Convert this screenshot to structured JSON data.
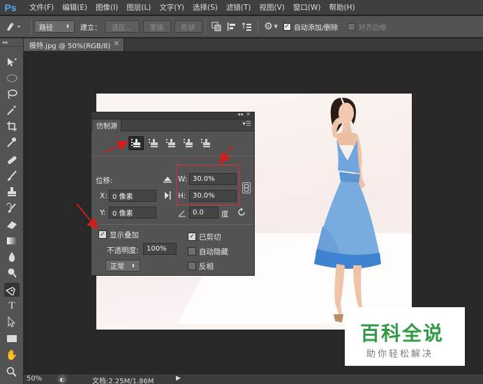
{
  "app": {
    "logo": "Ps"
  },
  "menu": [
    "文件(F)",
    "编辑(E)",
    "图像(I)",
    "图层(L)",
    "文字(Y)",
    "选择(S)",
    "滤镜(T)",
    "视图(V)",
    "窗口(W)",
    "帮助(H)"
  ],
  "options": {
    "mode_value": "路径",
    "make_label": "建立：",
    "selection_button": "选区...",
    "mask_button": "蒙版",
    "shape_button": "形状",
    "auto_add_label": "自动添加/删除",
    "auto_add_checked": true,
    "align_edges_label": "对齐边缘",
    "align_edges_checked": false
  },
  "document_tab": {
    "title": "模特.jpg @ 50%(RGB/8)",
    "close": "×"
  },
  "tools": [
    "move-tool",
    "marquee-tool",
    "lasso-tool",
    "magic-wand-tool",
    "crop-tool",
    "eyedropper-tool",
    "healing-brush-tool",
    "brush-tool",
    "clone-stamp-tool",
    "history-brush-tool",
    "eraser-tool",
    "gradient-tool",
    "blur-tool",
    "dodge-tool",
    "pen-tool",
    "type-tool",
    "path-selection-tool",
    "rectangle-tool",
    "hand-tool",
    "zoom-tool"
  ],
  "clone_source_panel": {
    "tab_label": "仿制源",
    "offset_label": "位移:",
    "x_label": "X:",
    "x_value": "0 像素",
    "y_label": "Y:",
    "y_value": "0 像素",
    "w_label": "W:",
    "w_value": "30.0%",
    "h_label": "H:",
    "h_value": "30.0%",
    "angle_value": "0.0",
    "angle_unit": "度",
    "show_overlay_label": "显示叠加",
    "show_overlay_checked": true,
    "opacity_label": "不透明度:",
    "opacity_value": "100%",
    "blend_mode": "正常",
    "clipped_label": "已剪切",
    "clipped_checked": true,
    "auto_hide_label": "自动隐藏",
    "auto_hide_checked": false,
    "invert_label": "反相",
    "invert_checked": false
  },
  "status": {
    "zoom": "50%",
    "doc_info": "文档:2.25M/1.86M"
  },
  "watermark": {
    "title": "百科全说",
    "subtitle": "助你轻松解决"
  },
  "colors": {
    "accent_red": "#e03030",
    "dress_blue": "#4f8fd6",
    "watermark_green": "#2f9b44",
    "ps_blue": "#4fa9f0"
  }
}
